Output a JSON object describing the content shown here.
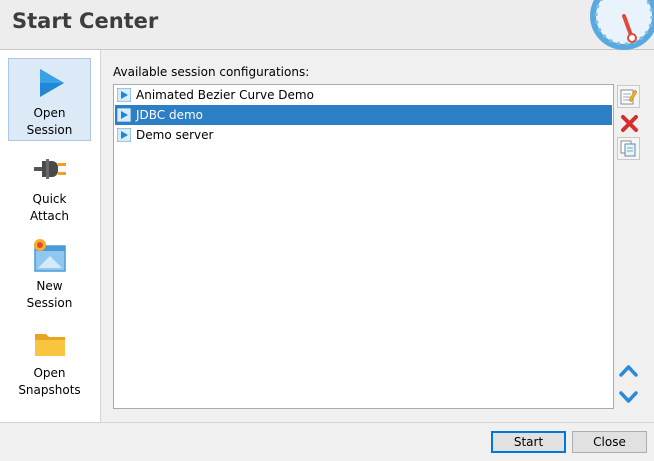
{
  "window": {
    "title": "Start Center"
  },
  "sidebar": {
    "items": [
      {
        "label": "Open\nSession",
        "icon": "play-icon",
        "selected": true
      },
      {
        "label": "Quick\nAttach",
        "icon": "plug-icon",
        "selected": false
      },
      {
        "label": "New\nSession",
        "icon": "new-session-icon",
        "selected": false
      },
      {
        "label": "Open\nSnapshots",
        "icon": "folder-icon",
        "selected": false
      }
    ]
  },
  "main": {
    "list_label": "Available session configurations:",
    "sessions": [
      {
        "label": "Animated Bezier Curve Demo",
        "selected": false
      },
      {
        "label": "JDBC demo",
        "selected": true
      },
      {
        "label": "Demo server",
        "selected": false
      }
    ],
    "tools": [
      "edit-icon",
      "delete-icon",
      "copy-icon",
      "move-up-icon",
      "move-down-icon"
    ]
  },
  "footer": {
    "start_label": "Start",
    "close_label": "Close"
  },
  "colors": {
    "selection": "#2c7fc5",
    "accent": "#0078d7",
    "delete": "#d32f2f"
  }
}
